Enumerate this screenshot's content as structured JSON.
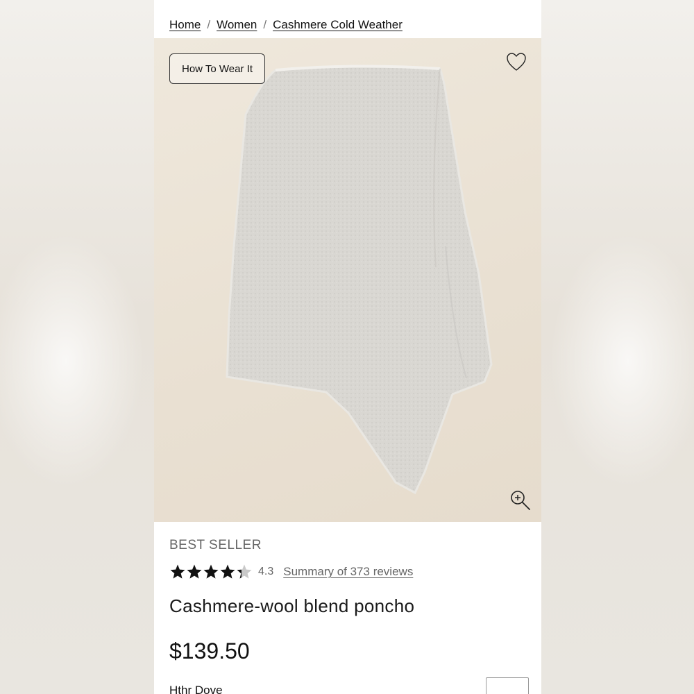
{
  "breadcrumb": {
    "items": [
      "Home",
      "Women",
      "Cashmere Cold Weather"
    ],
    "separator": "/"
  },
  "image": {
    "how_to_wear_label": "How To Wear It",
    "wishlist_icon": "heart-outline-icon",
    "zoom_icon": "zoom-in-icon",
    "background_color": "#ebe3d6",
    "garment_color": "#d8d6d1"
  },
  "product": {
    "badge": "BEST SELLER",
    "rating": 4.3,
    "rating_text": "4.3",
    "rating_max": 5,
    "reviews_link": "Summary of 373 reviews",
    "title": "Cashmere-wool blend poncho",
    "price": "$139.50",
    "color_name": "Hthr Dove"
  }
}
